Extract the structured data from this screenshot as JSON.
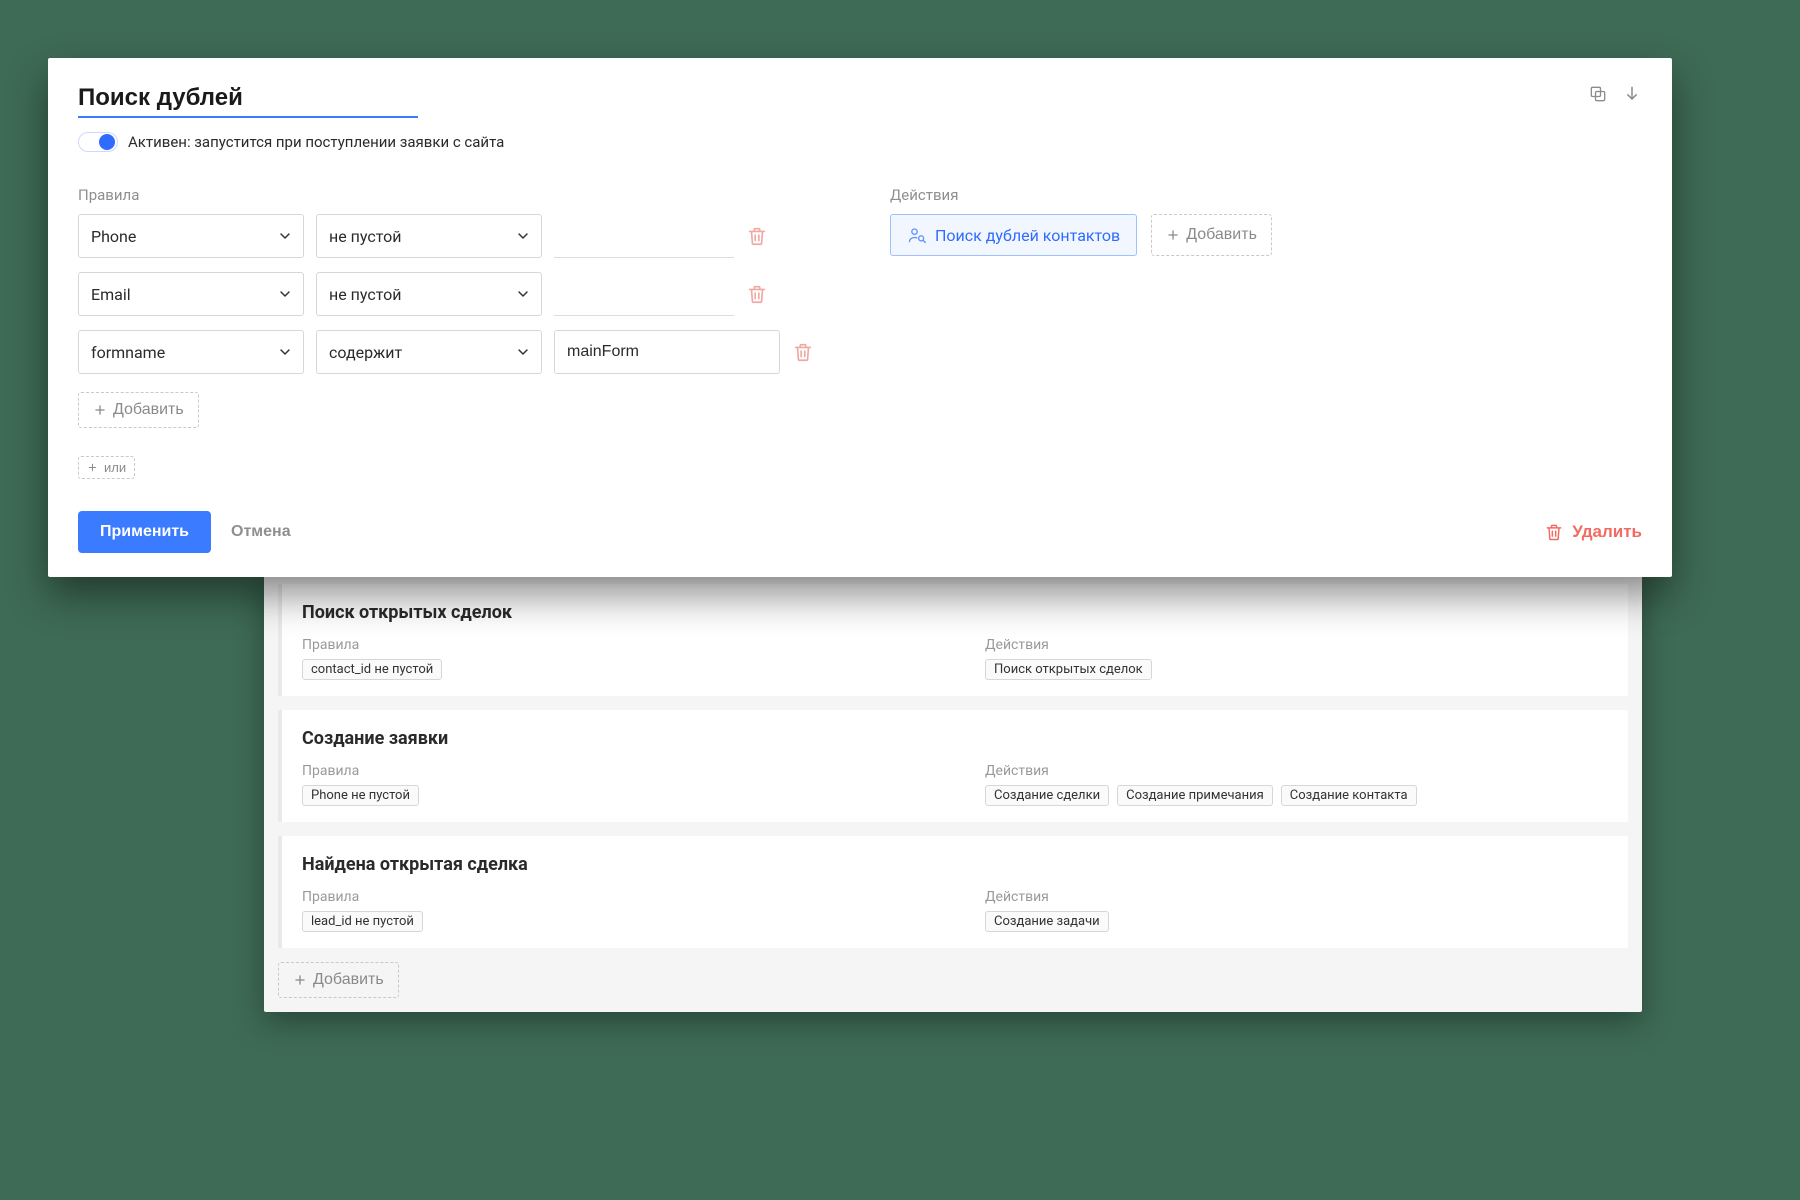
{
  "editor": {
    "title": "Поиск дублей",
    "toggle_label": "Активен: запустится при поступлении заявки с сайта",
    "rules_label": "Правила",
    "actions_label": "Действия",
    "rules": [
      {
        "field": "Phone",
        "op": "не пустой",
        "value": ""
      },
      {
        "field": "Email",
        "op": "не пустой",
        "value": ""
      },
      {
        "field": "formname",
        "op": "содержит",
        "value": "mainForm"
      }
    ],
    "add_rule_label": "Добавить",
    "or_label": "или",
    "action_chip": "Поиск дублей контактов",
    "add_action_label": "Добавить",
    "apply_label": "Применить",
    "cancel_label": "Отмена",
    "delete_label": "Удалить"
  },
  "list": {
    "rules_label": "Правила",
    "actions_label": "Действия",
    "add_label": "Добавить",
    "items": [
      {
        "title": "Поиск открытых сделок",
        "rules": [
          "contact_id не пустой"
        ],
        "actions": [
          "Поиск открытых сделок"
        ]
      },
      {
        "title": "Создание заявки",
        "rules": [
          "Phone не пустой"
        ],
        "actions": [
          "Создание сделки",
          "Создание примечания",
          "Создание контакта"
        ]
      },
      {
        "title": "Найдена открытая сделка",
        "rules": [
          "lead_id не пустой"
        ],
        "actions": [
          "Создание задачи"
        ]
      }
    ]
  }
}
